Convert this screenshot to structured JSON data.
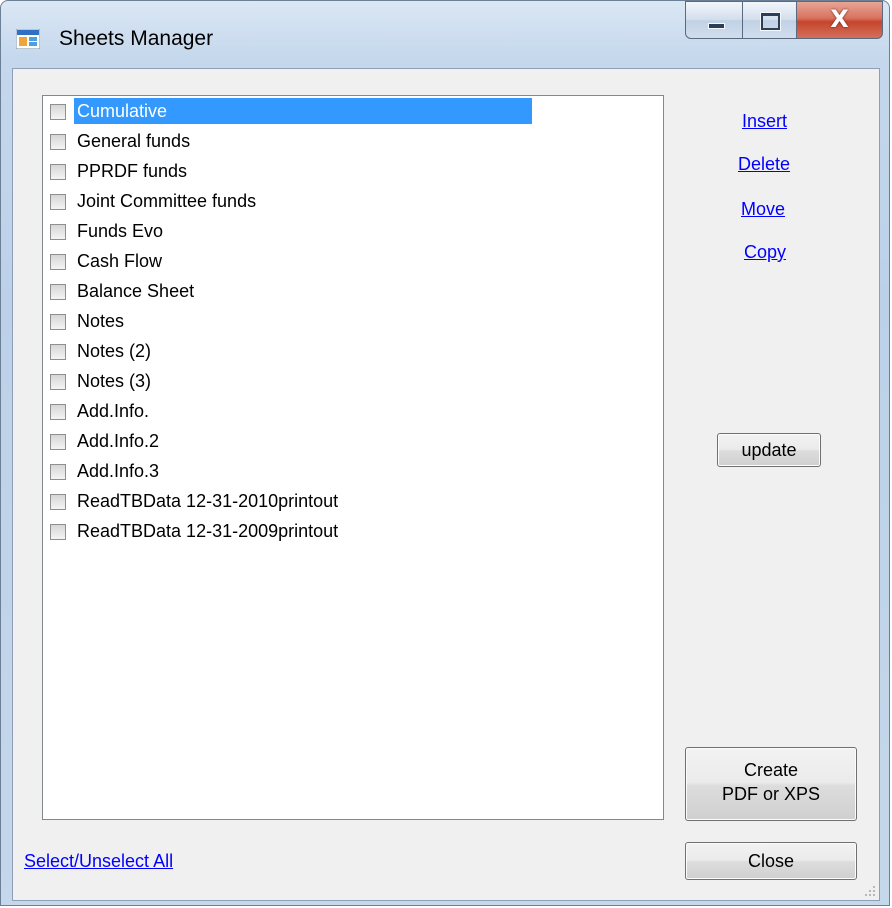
{
  "window": {
    "title": "Sheets Manager",
    "close_glyph": "X"
  },
  "sheets": {
    "items": [
      {
        "label": "Cumulative",
        "checked": false,
        "selected": true
      },
      {
        "label": "General funds",
        "checked": false,
        "selected": false
      },
      {
        "label": "PPRDF funds",
        "checked": false,
        "selected": false
      },
      {
        "label": "Joint Committee funds",
        "checked": false,
        "selected": false
      },
      {
        "label": "Funds Evo",
        "checked": false,
        "selected": false
      },
      {
        "label": "Cash Flow",
        "checked": false,
        "selected": false
      },
      {
        "label": "Balance Sheet",
        "checked": false,
        "selected": false
      },
      {
        "label": "Notes",
        "checked": false,
        "selected": false
      },
      {
        "label": "Notes (2)",
        "checked": false,
        "selected": false
      },
      {
        "label": "Notes (3)",
        "checked": false,
        "selected": false
      },
      {
        "label": "Add.Info.",
        "checked": false,
        "selected": false
      },
      {
        "label": "Add.Info.2",
        "checked": false,
        "selected": false
      },
      {
        "label": "Add.Info.3",
        "checked": false,
        "selected": false
      },
      {
        "label": "ReadTBData 12-31-2010printout",
        "checked": false,
        "selected": false
      },
      {
        "label": "ReadTBData 12-31-2009printout",
        "checked": false,
        "selected": false
      }
    ]
  },
  "actions": {
    "insert": "Insert",
    "delete": "Delete",
    "move": "Move",
    "copy": "Copy",
    "update": "update",
    "create_line1": "Create",
    "create_line2": "PDF or XPS",
    "close": "Close",
    "select_all": "Select/Unselect All"
  },
  "colors": {
    "selection": "#3399ff",
    "link": "#0000ff",
    "client_bg": "#f0f0f0"
  }
}
